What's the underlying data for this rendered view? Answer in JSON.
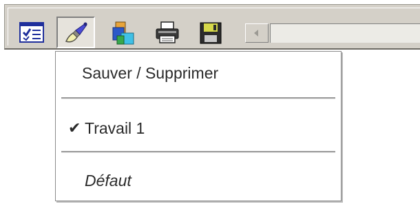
{
  "toolbar": {
    "buttons": [
      {
        "icon": "checklist-form-icon",
        "pressed": false
      },
      {
        "icon": "paint-brush-icon",
        "pressed": true
      },
      {
        "icon": "colored-blocks-icon",
        "pressed": false
      },
      {
        "icon": "printer-icon",
        "pressed": false
      },
      {
        "icon": "floppy-disk-icon",
        "pressed": false
      }
    ],
    "scroll_arrow_glyph": "◄"
  },
  "menu": {
    "items": [
      {
        "label": "Sauver / Supprimer",
        "checked": false,
        "italic": false
      },
      {
        "label": "Travail 1",
        "checked": true,
        "italic": false,
        "check_glyph": "✔"
      },
      {
        "label": "Défaut",
        "checked": false,
        "italic": true
      }
    ]
  },
  "colors": {
    "toolbar_bg": "#d4d0c8",
    "menu_bg": "#ffffff",
    "menu_text": "#2a2a2a",
    "separator": "#9c9c9c"
  }
}
